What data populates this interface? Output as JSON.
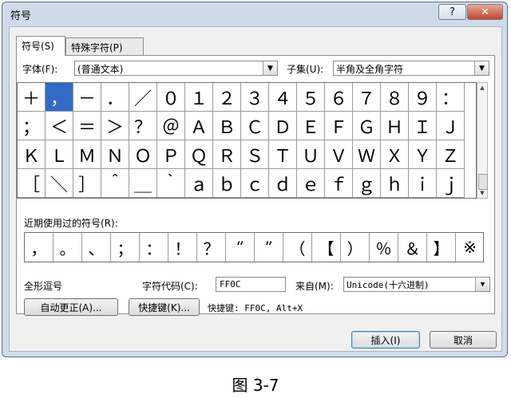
{
  "window": {
    "title": "符号",
    "help": "?",
    "close": "✕"
  },
  "tabs": [
    {
      "label": "符号(S)"
    },
    {
      "label": "特殊字符(P)"
    }
  ],
  "font": {
    "label": "字体(F):",
    "value": "(普通文本)"
  },
  "subset": {
    "label": "子集(U):",
    "value": "半角及全角字符"
  },
  "symbols": [
    "＋",
    "，",
    "－",
    "．",
    "／",
    "０",
    "１",
    "２",
    "３",
    "４",
    "５",
    "６",
    "７",
    "８",
    "９",
    "：",
    "；",
    "＜",
    "＝",
    "＞",
    "？",
    "＠",
    "Ａ",
    "Ｂ",
    "Ｃ",
    "Ｄ",
    "Ｅ",
    "Ｆ",
    "Ｇ",
    "Ｈ",
    "Ｉ",
    "Ｊ",
    "Ｋ",
    "Ｌ",
    "Ｍ",
    "Ｎ",
    "Ｏ",
    "Ｐ",
    "Ｑ",
    "Ｒ",
    "Ｓ",
    "Ｔ",
    "Ｕ",
    "Ｖ",
    "Ｗ",
    "Ｘ",
    "Ｙ",
    "Ｚ",
    "［",
    "＼",
    "］",
    "＾",
    "＿",
    "｀",
    "ａ",
    "ｂ",
    "ｃ",
    "ｄ",
    "ｅ",
    "ｆ",
    "ｇ",
    "ｈ",
    "ｉ",
    "ｊ"
  ],
  "selected_index": 1,
  "recent": {
    "label": "近期使用过的符号(R):",
    "items": [
      "，",
      "。",
      "、",
      "；",
      "：",
      "！",
      "？",
      "“",
      "”",
      "（",
      "【",
      "）",
      "％",
      "＆",
      "】",
      "※"
    ]
  },
  "char_name": "全形逗号",
  "char_code": {
    "label": "字符代码(C):",
    "value": "FF0C"
  },
  "from": {
    "label": "来自(M):",
    "value": "Unicode(十六进制)"
  },
  "buttons": {
    "autocorrect": "自动更正(A)...",
    "shortcut_key": "快捷键(K)...",
    "insert": "插入(I)",
    "cancel": "取消"
  },
  "shortcut_info": "快捷键: FF0C, Alt+X",
  "caption": "图 3-7"
}
